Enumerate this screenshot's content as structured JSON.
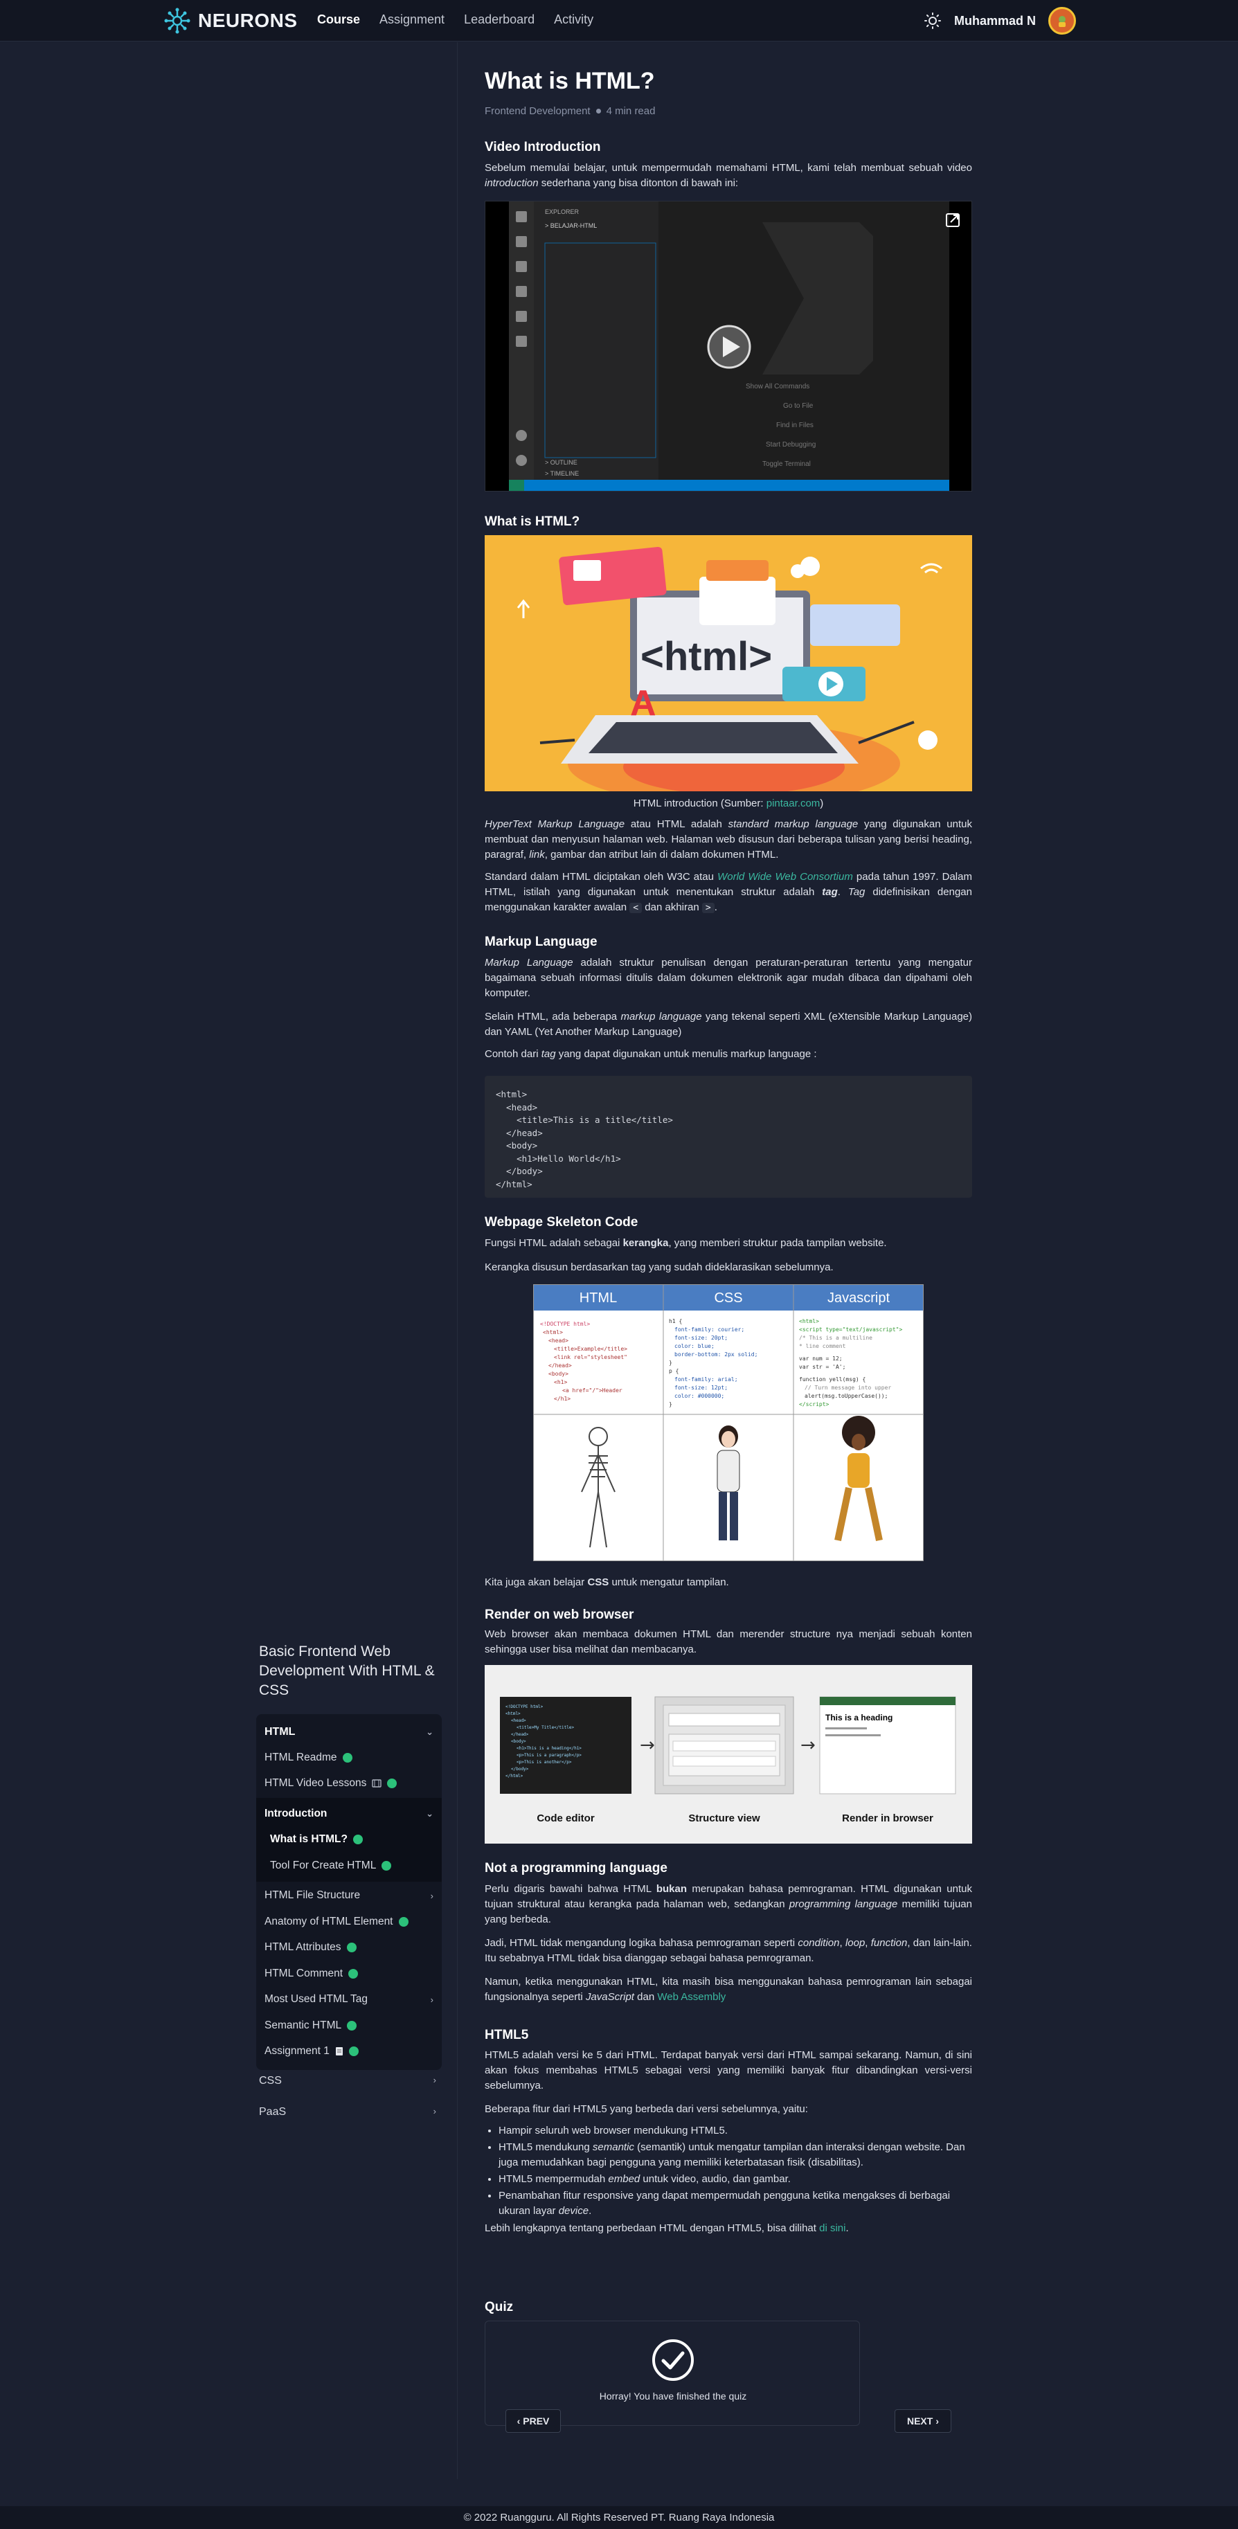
{
  "brand": {
    "name": "NEURONS"
  },
  "nav": {
    "links": [
      "Course",
      "Assignment",
      "Leaderboard",
      "Activity"
    ],
    "active": "Course"
  },
  "user": {
    "name": "Muhammad N"
  },
  "sidebar": {
    "course_title": "Basic Frontend Web Development With HTML & CSS",
    "group": "HTML",
    "items": [
      {
        "label": "HTML Readme",
        "done": true
      },
      {
        "label": "HTML Video Lessons",
        "done": true,
        "icon": "video-icon"
      }
    ],
    "subgroup": {
      "label": "Introduction",
      "items": [
        {
          "label": "What is HTML?",
          "done": true
        },
        {
          "label": "Tool For Create HTML",
          "done": true
        }
      ]
    },
    "items_after": [
      {
        "label": "HTML File Structure",
        "chevron": true
      },
      {
        "label": "Anatomy of HTML Element",
        "done": true
      },
      {
        "label": "HTML Attributes",
        "done": true
      },
      {
        "label": "HTML Comment",
        "done": true
      },
      {
        "label": "Most Used HTML Tag",
        "chevron": true
      },
      {
        "label": "Semantic HTML",
        "done": true
      },
      {
        "label": "Assignment 1",
        "done": true,
        "icon": "document-icon"
      }
    ],
    "other_groups": [
      "CSS",
      "PaaS"
    ]
  },
  "article": {
    "title": "What is HTML?",
    "category": "Frontend Development",
    "read_time": "4 min read",
    "video_heading": "Video Introduction",
    "video_intro_1": "Sebelum memulai belajar, untuk mempermudah memahami HTML, kami telah membuat sebuah video ",
    "video_intro_em": "introduction",
    "video_intro_2": " sederhana yang bisa ditonton di bawah ini:",
    "what_heading": "What is HTML?",
    "figure_caption_1": "HTML introduction (Sumber: ",
    "figure_caption_link": "pintaar.com",
    "figure_caption_2": ")",
    "html_image_text": "<html>",
    "markup_heading": "Markup Language",
    "skeleton_heading": "Webpage Skeleton Code",
    "skeleton_p1_a": "Fungsi HTML adalah sebagai ",
    "skeleton_p1_b": "kerangka",
    "skeleton_p1_c": ", yang memberi struktur pada tampilan website.",
    "skeleton_p2": "Kerangka disusun berdasarkan tag yang sudah dideklarasikan sebelumnya.",
    "table_headers": [
      "HTML",
      "CSS",
      "Javascript"
    ],
    "css_note_a": "Kita juga akan belajar ",
    "css_note_b": "CSS",
    "css_note_c": " untuk mengatur tampilan.",
    "render_heading": "Render on web browser",
    "render_p": "Web browser akan membaca dokumen HTML dan merender structure nya menjadi sebuah konten sehingga user bisa melihat dan membacanya.",
    "render_labels": [
      "Code editor",
      "Structure view",
      "Render in browser"
    ],
    "render_heading_text": "This is a heading",
    "notprog_heading": "Not a programming language",
    "html5_heading": "HTML5",
    "html5_p1": "HTML5 adalah versi ke 5 dari HTML. Terdapat banyak versi dari HTML sampai sekarang. Namun, di sini akan fokus membahas HTML5 sebagai versi yang memiliki banyak fitur dibandingkan versi-versi sebelumnya.",
    "html5_p2": "Beberapa fitur dari HTML5 yang berbeda dari versi sebelumnya, yaitu:",
    "html5_more_a": "Lebih lengkapnya tentang perbedaan HTML dengan HTML5, bisa dilihat ",
    "html5_more_link": "di sini",
    "html5_more_b": ".",
    "quiz_heading": "Quiz",
    "quiz_message": "Horray! You have finished the quiz",
    "prev_label": "PREV",
    "next_label": "NEXT",
    "code_example": "<html>\n  <head>\n    <title>This is a title</title>\n  </head>\n  <body>\n    <h1>Hello World</h1>\n  </body>\n</html>"
  },
  "footer": {
    "text": "© 2022 Ruangguru. All Rights Reserved PT. Ruang Raya Indonesia"
  },
  "colors": {
    "accent": "#3bb8a0",
    "done": "#2cc17a",
    "bg": "#1b2030",
    "header": "#121622"
  }
}
